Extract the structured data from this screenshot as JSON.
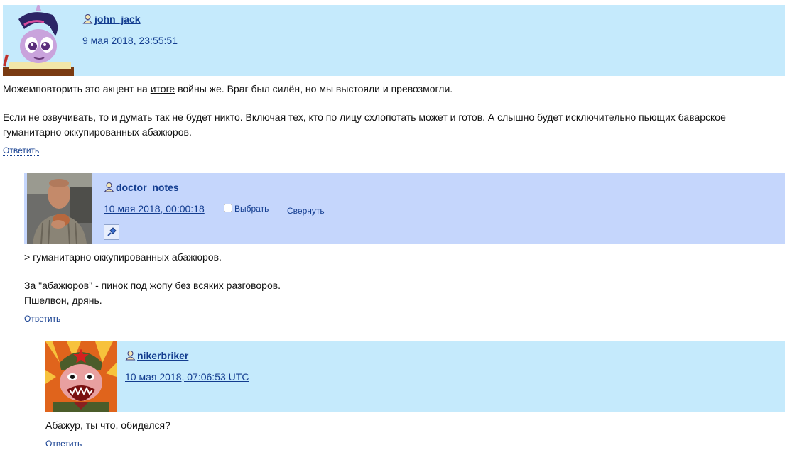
{
  "comments": [
    {
      "username": "john_jack",
      "date": "9 мая 2018, 23:55:51",
      "body": {
        "p1_before": "Можемповторить это акцент на ",
        "p1_link": "итоге",
        "p1_after": " войны же. Враг был силён, но мы выстояли и превозмогли.",
        "p2": "Если не озвучивать, то и думать так не будет никто. Включая тех, кто по лицу схлопотать может и готов. А слышно будет исключительно пьющих баварское гуманитарно оккупированных абажюров."
      },
      "reply_label": "Ответить",
      "header_color": "#c5eafc",
      "avatar_icon": "pony-avatar"
    },
    {
      "username": "doctor_notes",
      "date": "10 мая 2018, 00:00:18",
      "select_label": "Выбрать",
      "collapse_label": "Свернуть",
      "pin_icon": "pin-icon",
      "body": {
        "p1": "> гуманитарно оккупированных абажюров.",
        "p2": "За \"абажюров\" - пинок под жопу без всяких разговоров.",
        "p3": "Пшелвон, дрянь."
      },
      "reply_label": "Ответить",
      "header_color": "#c5d6fc",
      "avatar_icon": "man-photo-avatar"
    },
    {
      "username": "nikerbriker",
      "date": "10 мая 2018, 07:06:53 UTC",
      "body": {
        "p1": "Абажур, ты что, обиделся?"
      },
      "reply_label": "Ответить",
      "header_color": "#c5eafc",
      "avatar_icon": "cartoon-soldier-avatar"
    }
  ]
}
